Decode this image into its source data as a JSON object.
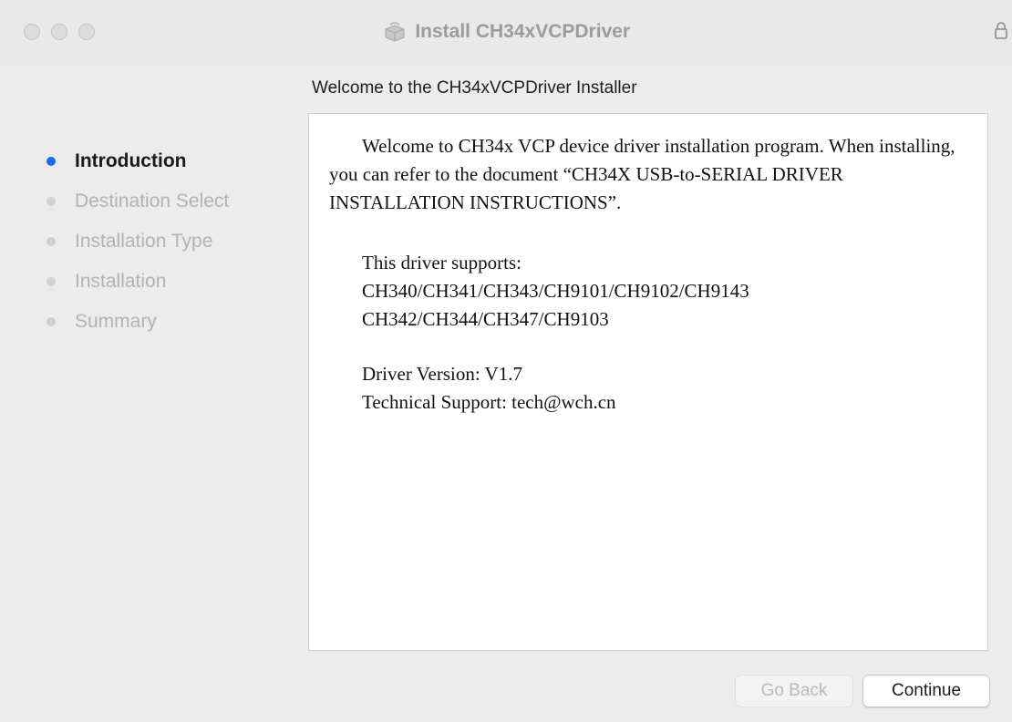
{
  "window": {
    "title": "Install CH34xVCPDriver"
  },
  "heading": "Welcome to the CH34xVCPDriver Installer",
  "sidebar": {
    "steps": [
      {
        "label": "Introduction",
        "active": true
      },
      {
        "label": "Destination Select",
        "active": false
      },
      {
        "label": "Installation Type",
        "active": false
      },
      {
        "label": "Installation",
        "active": false
      },
      {
        "label": "Summary",
        "active": false
      }
    ]
  },
  "content": {
    "intro": "Welcome to CH34x VCP device driver installation program. When installing, you can refer to the document “CH34X USB-to-SERIAL DRIVER INSTALLATION INSTRUCTIONS”.",
    "supports_label": "This driver supports:",
    "supports_line1": "CH340/CH341/CH343/CH9101/CH9102/CH9143",
    "supports_line2": "CH342/CH344/CH347/CH9103",
    "version": "Driver Version: V1.7",
    "support": "Technical Support: tech@wch.cn"
  },
  "buttons": {
    "back": "Go Back",
    "continue": "Continue"
  },
  "colors": {
    "accent": "#1a6cf0",
    "inactive_step": "#b2b2b2"
  }
}
